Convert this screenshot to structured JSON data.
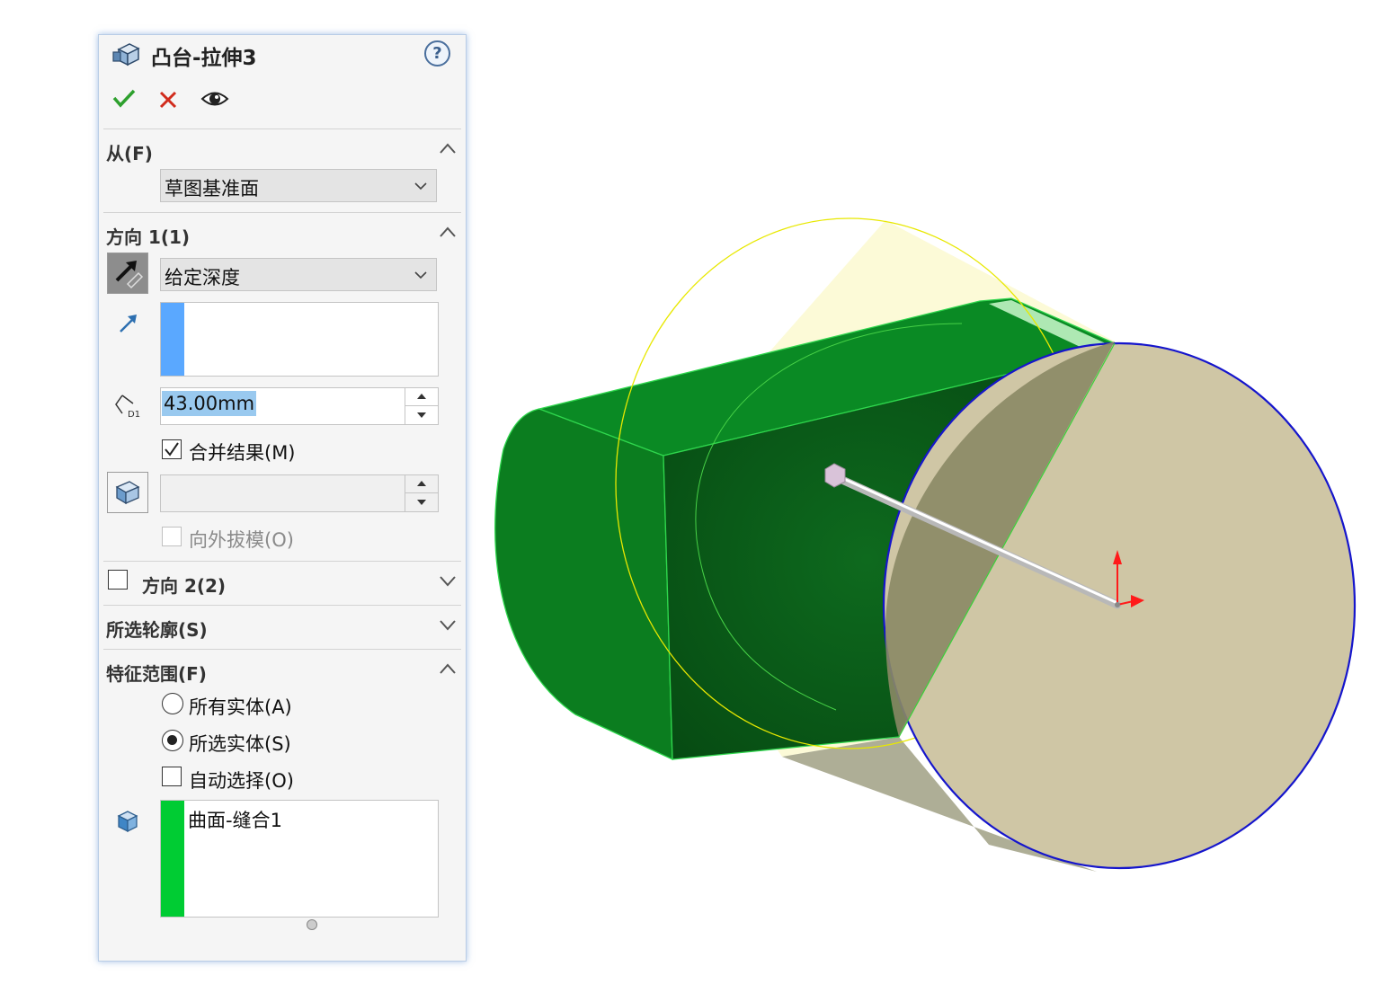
{
  "panel": {
    "title": "凸台-拉伸3",
    "help_label": "?",
    "sections": {
      "from": {
        "label": "从(F)",
        "dropdown_value": "草图基准面"
      },
      "direction1": {
        "label": "方向 1(1)",
        "end_condition": "给定深度",
        "depth_value": "43.00mm",
        "merge_result_label": "合并结果(M)",
        "merge_result_checked": true,
        "draft_outward_label": "向外拔模(O)",
        "draft_outward_checked": false
      },
      "direction2": {
        "label": "方向 2(2)",
        "checked": false
      },
      "selected_contours": {
        "label": "所选轮廓(S)"
      },
      "feature_scope": {
        "label": "特征范围(F)",
        "all_bodies_label": "所有实体(A)",
        "selected_bodies_label": "所选实体(S)",
        "auto_select_label": "自动选择(O)",
        "selected_option": "selected_bodies",
        "bodies_list": [
          "曲面-缝合1"
        ]
      }
    }
  },
  "colors": {
    "ok_green": "#2ea02e",
    "cancel_red": "#d12b1c",
    "selection_blue": "#5aa8ff",
    "body_list_green": "#00cc33",
    "model_green": "#0a7a1c",
    "cylinder_face": "#cfc6a5",
    "yellow_outline": "#e8e800",
    "circle_edge_blue": "#1515cc"
  }
}
